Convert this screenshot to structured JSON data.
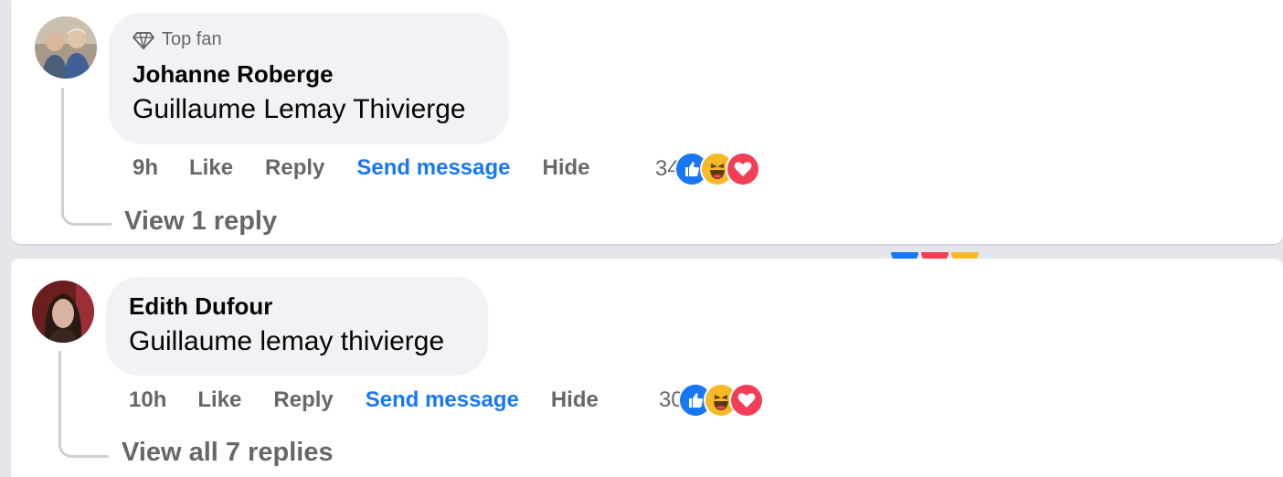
{
  "comments": [
    {
      "badge_label": "Top fan",
      "author": "Johanne Roberge",
      "text": "Guillaume Lemay Thivierge",
      "time": "9h",
      "like_label": "Like",
      "reply_label": "Reply",
      "send_label": "Send message",
      "hide_label": "Hide",
      "reaction_count": "34",
      "view_replies_label": "View 1 reply"
    },
    {
      "author": "Edith Dufour",
      "text": "Guillaume lemay thivierge",
      "time": "10h",
      "like_label": "Like",
      "reply_label": "Reply",
      "send_label": "Send message",
      "hide_label": "Hide",
      "reaction_count": "30",
      "view_replies_label": "View all 7 replies"
    }
  ],
  "reaction_icons": [
    "like-icon",
    "haha-icon",
    "love-icon"
  ],
  "colors": {
    "link": "#1877f2",
    "muted": "#65676b",
    "bubble": "#f0f2f5",
    "like": "#1877f2",
    "haha": "#f7b928",
    "love": "#f33e58"
  }
}
